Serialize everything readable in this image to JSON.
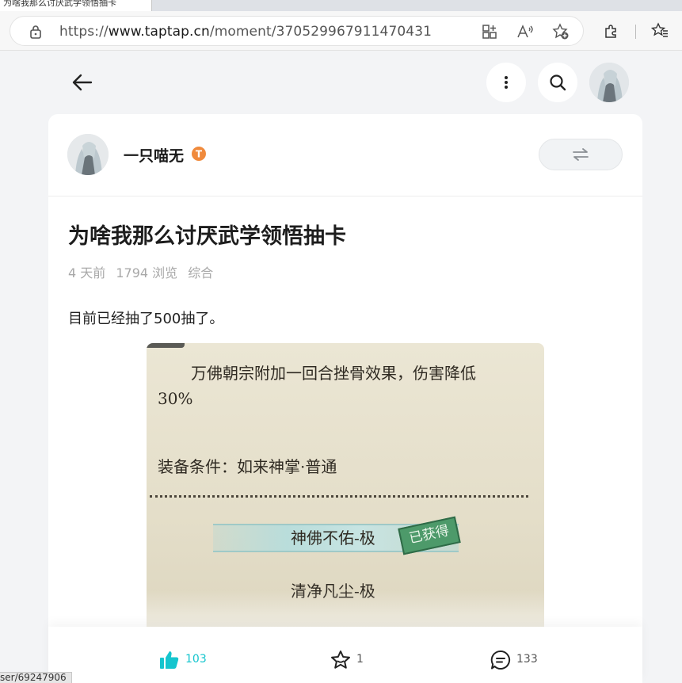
{
  "browser": {
    "tab_title": "为啥我那么讨厌武学领悟抽卡",
    "url_scheme": "https://",
    "url_host": "www.taptap.cn",
    "url_path": "/moment/370529967911470431",
    "status_url": "ser/69247906"
  },
  "header": {
    "back_icon": "arrow-left-icon",
    "more_icon": "vertical-dots-icon",
    "search_icon": "search-icon"
  },
  "author": {
    "name": "一只喵无",
    "badge_letter": "T",
    "badge_color": "#f08a3c"
  },
  "post": {
    "title": "为啥我那么讨厌武学领悟抽卡",
    "meta": [
      "4 天前",
      "1794 浏览",
      "综合"
    ],
    "body": "目前已经抽了500抽了。"
  },
  "image": {
    "line1": "万佛朝宗附加一回合挫骨效果，伤害降低",
    "line2": "30%",
    "line3": "装备条件：如来神掌·普通",
    "item1": "神佛不佑-极",
    "stamp": "已获得",
    "item2": "清净凡尘-极"
  },
  "actions": {
    "like_count": "103",
    "star_count": "1",
    "comment_count": "133",
    "accent_color": "#15c5ce"
  }
}
